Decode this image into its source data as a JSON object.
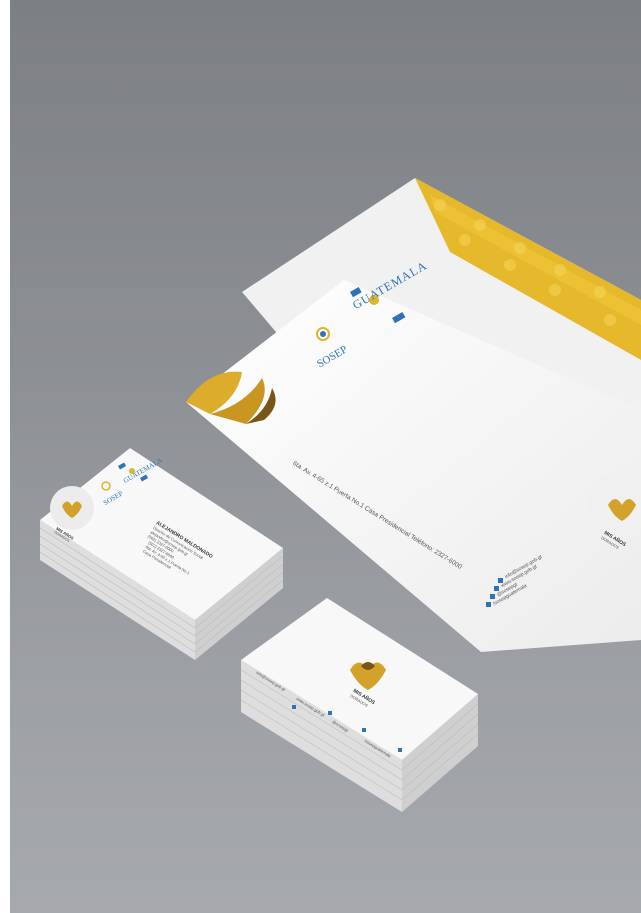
{
  "colors": {
    "background": "#8a8d92",
    "gold": "#e0b52a",
    "gold_dark": "#c8961e",
    "brown": "#7a5518",
    "blue": "#2d73b8",
    "paper": "#f7f7f7"
  },
  "letterhead": {
    "brand_name": "GUATEMALA",
    "org_name": "SOSEP",
    "address_line": "6ta. Av. 4-65 z.1 Puerta No.1 Casa Presidencial Teléfono: 2327-6000",
    "contacts": [
      "info@sosep.gob.gt",
      "www.sosep.gob.gt",
      "@sosepgt",
      "/sosepguatemala"
    ],
    "badge_title": "MIS AÑOS",
    "badge_subtitle": "DORADOS"
  },
  "business_card_front": {
    "brand_name": "GUATEMALA",
    "org_name": "SOSEP",
    "person_name": "ALEJANDRO MALDONADO",
    "person_role": "Director de Comunicación Social",
    "email": "alejandro@sosep.gob.gt",
    "phone_1": "(502) 2327-6000",
    "phone_2": "(502) 2327-6000",
    "address_1": "6ta. Av. 4-65 z.1 Puerta No.1",
    "address_2": "Casa Presidencial",
    "badge_title": "MIS AÑOS",
    "badge_subtitle": "DORADOS"
  },
  "business_card_back": {
    "badge_title": "MIS AÑOS",
    "badge_subtitle": "DORADOS",
    "contacts": [
      "info@sosep.gob.gt",
      "www.sosep.gob.gt",
      "@sosepgt",
      "/sosepguatemala"
    ]
  }
}
